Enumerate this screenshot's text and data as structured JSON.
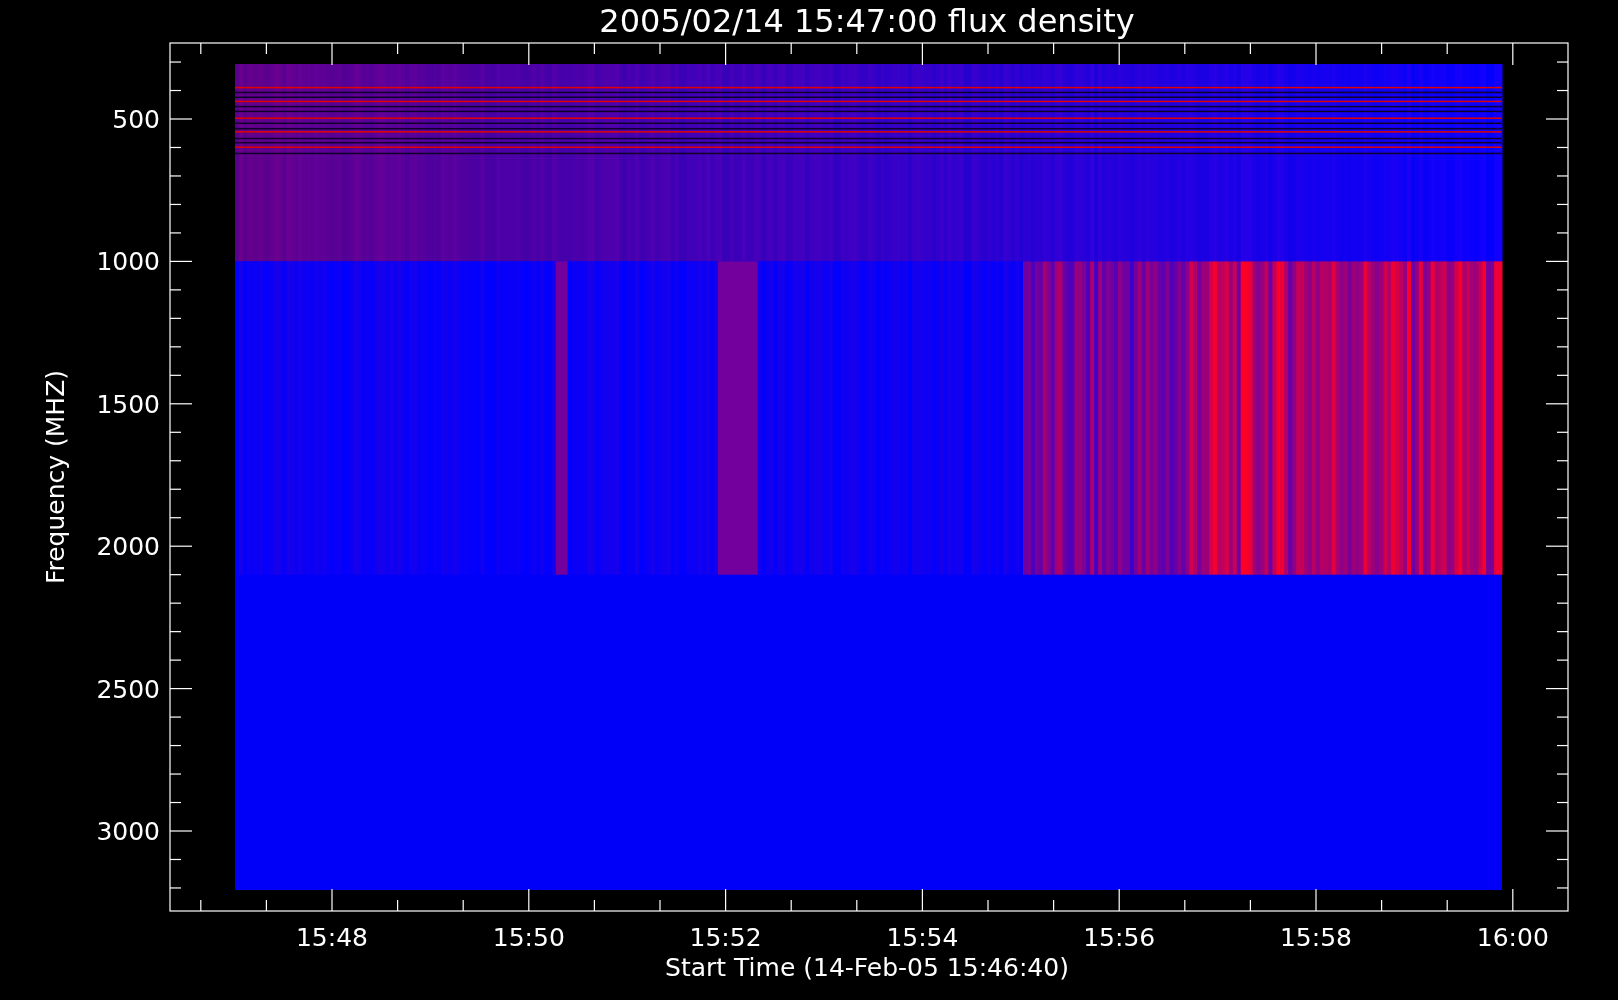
{
  "title": "2005/02/14 15:47:00 flux density",
  "y_axis": {
    "label": "Frequency (MHZ)",
    "ticks": [
      "500",
      "1000",
      "1500",
      "2000",
      "2500",
      "3000"
    ]
  },
  "x_axis": {
    "label": "Start Time (14-Feb-05 15:46:40)",
    "ticks": [
      "15:48",
      "15:50",
      "15:52",
      "15:54",
      "15:56",
      "15:58",
      "16:00"
    ]
  }
}
